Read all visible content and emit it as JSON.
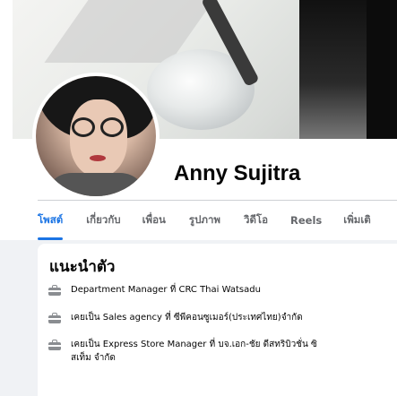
{
  "profile": {
    "name": "Anny Sujitra"
  },
  "tabs": [
    {
      "label": "โพสต์",
      "active": true
    },
    {
      "label": "เกี่ยวกับ",
      "active": false
    },
    {
      "label": "เพื่อน",
      "active": false
    },
    {
      "label": "รูปภาพ",
      "active": false
    },
    {
      "label": "วิดีโอ",
      "active": false
    },
    {
      "label": "Reels",
      "active": false
    },
    {
      "label": "เพิ่มเติ",
      "active": false
    }
  ],
  "intro": {
    "title": "แนะนำตัว",
    "items": [
      {
        "icon": "briefcase-icon",
        "text": "Department Manager ที่ CRC Thai Watsadu"
      },
      {
        "icon": "briefcase-icon",
        "text": "เคยเป็น Sales agency ที่ ซีพีคอนซูเมอร์(ประเทศไทย)จำกัด"
      },
      {
        "icon": "briefcase-icon",
        "text": "เคยเป็น Express Store Manager ที่ บจ.เอก-ชัย ดีสทริบิวชั่น ซิสเท็ม จำกัด"
      }
    ]
  },
  "colors": {
    "accent": "#1b74e4",
    "muted_text": "#65676b",
    "page_bg": "#f0f2f5",
    "icon_gray": "#8a8d91"
  }
}
